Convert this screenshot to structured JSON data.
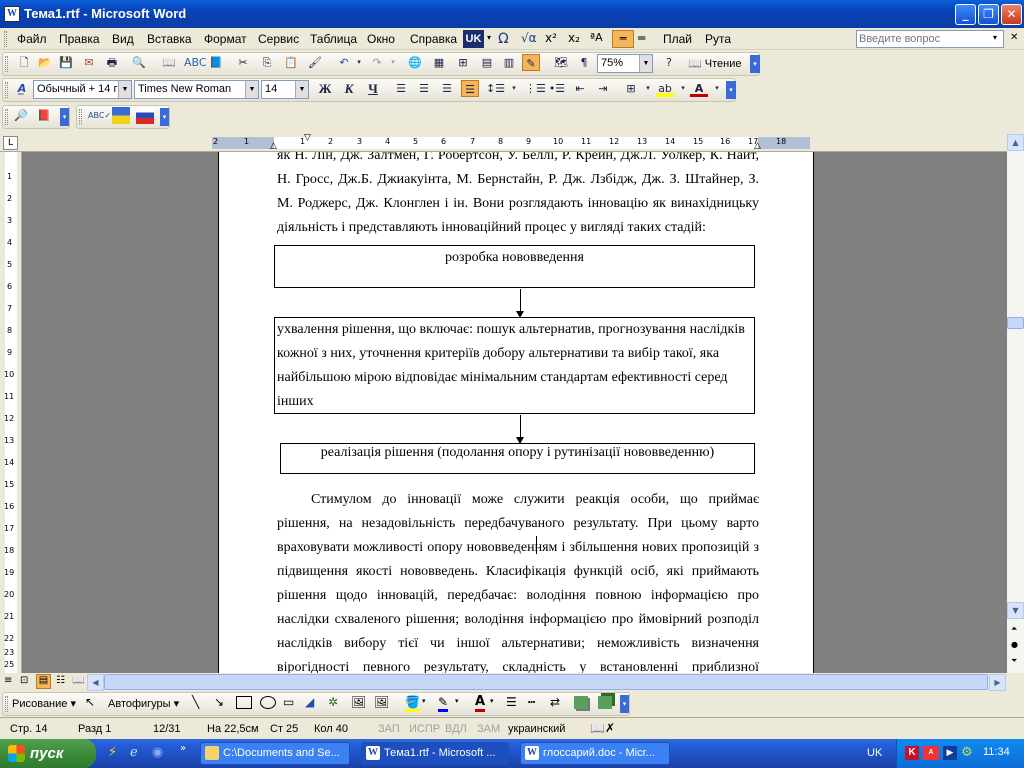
{
  "window": {
    "title": "Тема1.rtf - Microsoft Word",
    "minimize_glyph": "_",
    "restore_glyph": "❐",
    "close_glyph": "✕"
  },
  "menu": {
    "items": [
      "Файл",
      "Правка",
      "Вид",
      "Вставка",
      "Формат",
      "Сервис",
      "Таблица",
      "Окно",
      "Справка"
    ],
    "uk_badge": "UK",
    "read_label": "Плай",
    "mercury_label": "Рута",
    "question_placeholder": "Введите вопрос"
  },
  "standard_toolbar": {
    "zoom": "75%",
    "reading_label": "Чтение"
  },
  "format_toolbar": {
    "style": "Обычный + 14 г",
    "font": "Times New Roman",
    "size": "14",
    "bold": "Ж",
    "italic": "К",
    "underline": "Ч"
  },
  "ruler": {
    "labels": [
      "2",
      "1",
      "1",
      "2",
      "3",
      "4",
      "5",
      "6",
      "7",
      "8",
      "9",
      "10",
      "11",
      "12",
      "13",
      "14",
      "15",
      "16",
      "17",
      "18"
    ]
  },
  "vruler": {
    "labels": [
      "1",
      "2",
      "3",
      "4",
      "5",
      "6",
      "7",
      "8",
      "9",
      "10",
      "11",
      "12",
      "13",
      "14",
      "15",
      "16",
      "17",
      "18",
      "19",
      "20",
      "21",
      "22",
      "23",
      "24",
      "25"
    ]
  },
  "document": {
    "top_lines": [
      "як Н. Лін, Дж. Залтмен, Г. Робертсон, У. Беллі, Р. Крейн, Дж.Л. Уолкер, К. Найт,",
      "Н. Гросс, Дж.Б. Джиакуінта, М. Бернстайн, Р. Дж. Лзбідж, Дж. З. Штайнер, З.",
      "М. Роджерс, Дж. Клонглен і ін. Вони розглядають інновацію як винахідницьку",
      "діяльність і представляють інноваційний процес у вигляді таких стадій:"
    ],
    "box1": "розробка нововведення",
    "box2_lines": [
      "ухвалення рішення, що включає: пошук альтернатив, прогнозування наслідків",
      "кожної з них, уточнення критеріїв добору альтернативи та вибір такої, яка",
      "найбільшою мірою відповідає мінімальним стандартам ефективності серед",
      "інших"
    ],
    "box3": "реалізація рішення (подолання опору і рутинізації нововведенню)",
    "body_lines": [
      "Стимулом до інновації може служити реакція особи, що приймає",
      "рішення, на незадовільність передбачуваного результату. При цьому варто",
      "враховувати можливості опору нововведенням і збільшення нових пропозицій з",
      "підвищення якості нововведень. Класифікація функцій осіб, які приймають",
      "рішення щодо інновацій, передбачає: володіння повною інформацією про",
      "наслідки схваленого рішення; володіння інформацією про ймовірний розподіл",
      "наслідків вибору тієї чи іншої альтернативи; неможливість визначення",
      "вірогідності певного результату, складність у встановленні приблизної"
    ]
  },
  "drawing_toolbar": {
    "drawing": "Рисование ▾",
    "autoshapes": "Автофигуры ▾"
  },
  "status": {
    "page": "Стр. 14",
    "section": "Разд 1",
    "pages": "12/31",
    "at": "На 22,5см",
    "line": "Ст 25",
    "col": "Кол 40",
    "rec": "ЗАП",
    "trk": "ИСПР",
    "ext": "ВДЛ",
    "ovr": "ЗАМ",
    "language": "украинский"
  },
  "taskbar": {
    "start": "пуск",
    "tasks": [
      "C:\\Documents and Se...",
      "Тема1.rtf - Microsoft ...",
      "глоссарий.doc - Micr..."
    ],
    "lang": "UK",
    "clock": "11:34"
  },
  "colors": {
    "title_blue": "#0a4fc8",
    "task_blue": "#245edb",
    "start_green": "#3c8c3c",
    "highlight_orange": "#f4b65a"
  }
}
